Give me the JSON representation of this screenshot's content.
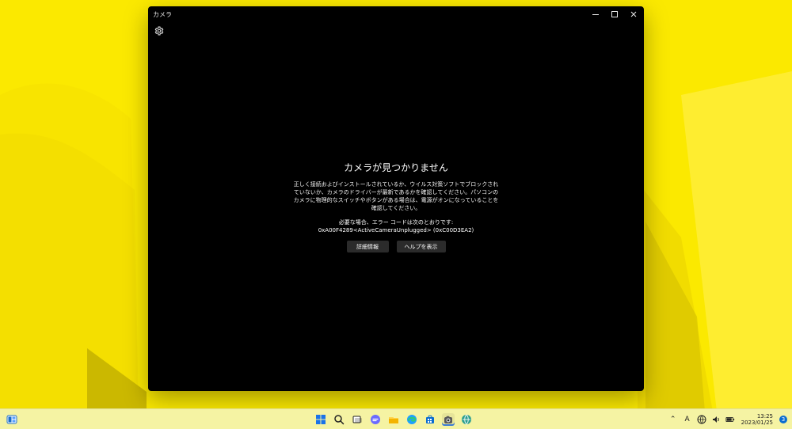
{
  "window": {
    "title": "カメラ"
  },
  "error": {
    "title": "カメラが見つかりません",
    "description": "正しく接続およびインストールされているか、ウイルス対策ソフトでブロックされていないか、カメラのドライバーが最新であるかを確認してください。パソコンのカメラに物理的なスイッチやボタンがある場合は、電源がオンになっていることを確認してください。",
    "code_label": "必要な場合、エラー コードは次のとおりです:",
    "code": "0xA00F4289<ActiveCameraUnplugged> (0xC00D3EA2)",
    "buttons": {
      "details": "詳細情報",
      "help": "ヘルプを表示"
    }
  },
  "taskbar": {
    "tray": {
      "ime": "A"
    },
    "clock": {
      "time": "13:25",
      "date": "2023/01/25"
    },
    "notifications": "3"
  },
  "colors": {
    "wallpaper_base": "#fbe900",
    "window_bg": "#000000",
    "taskbar_bg": "#f5f3a3",
    "accent_blue": "#0b6cd0"
  },
  "icons": {
    "settings": "gear-icon",
    "minimize": "minimize-icon",
    "maximize": "maximize-icon",
    "close": "close-icon",
    "widgets": "widgets-icon",
    "start": "windows-logo-icon",
    "search": "search-icon",
    "task_view": "task-view-icon",
    "chat": "chat-icon",
    "explorer": "folder-icon",
    "edge": "edge-icon",
    "store": "store-icon",
    "camera": "camera-icon",
    "globe": "globe-icon"
  }
}
